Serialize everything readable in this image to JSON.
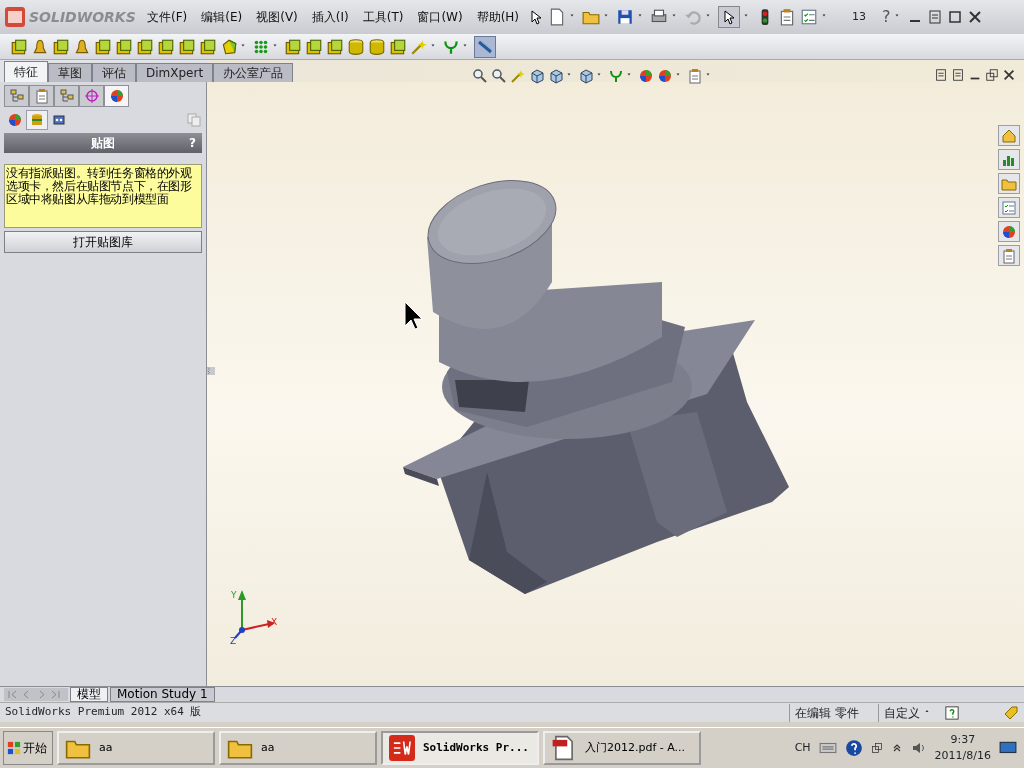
{
  "title_bar": {
    "logo_text": "SOLIDWORKS",
    "menus": [
      "文件(F)",
      "编辑(E)",
      "视图(V)",
      "插入(I)",
      "工具(T)",
      "窗口(W)",
      "帮助(H)"
    ],
    "counter": "13",
    "help": "?"
  },
  "command_tabs": [
    {
      "label": "特征",
      "selected": true
    },
    {
      "label": "草图",
      "selected": false
    },
    {
      "label": "评估",
      "selected": false
    },
    {
      "label": "DimXpert",
      "selected": false
    },
    {
      "label": "办公室产品",
      "selected": false
    }
  ],
  "panel": {
    "icon_tabs": [
      {
        "selected": false
      },
      {
        "selected": false
      },
      {
        "selected": false
      },
      {
        "selected": false
      },
      {
        "selected": true
      }
    ],
    "sub_icons": [
      {
        "selected": false
      },
      {
        "selected": true
      },
      {
        "selected": false
      }
    ],
    "title": "贴图",
    "help": "?",
    "message": "没有指派贴图。转到任务窗格的外观选项卡，然后在贴图节点下，在图形区域中将贴图从库拖动到模型面",
    "button": "打开贴图库"
  },
  "viewport": {
    "triad": {
      "x": "X",
      "y": "Y",
      "z": "Z"
    }
  },
  "bottom_tabs": [
    {
      "label": "模型",
      "selected": true
    },
    {
      "label": "Motion Study 1",
      "selected": false
    }
  ],
  "status_bar": {
    "product": "SolidWorks Premium 2012 x64 版",
    "mode": "在编辑 零件",
    "units": "自定义"
  },
  "taskbar": {
    "start": "开始",
    "tasks": [
      {
        "label": "aa",
        "kind": "folder",
        "selected": false
      },
      {
        "label": "aa",
        "kind": "folder",
        "selected": false
      },
      {
        "label": "SolidWorks Pr...",
        "kind": "solidworks",
        "selected": true
      },
      {
        "label": "入门2012.pdf - A...",
        "kind": "pdf",
        "selected": false
      }
    ],
    "language": "CH",
    "time": "9:37",
    "date": "2011/8/16"
  }
}
